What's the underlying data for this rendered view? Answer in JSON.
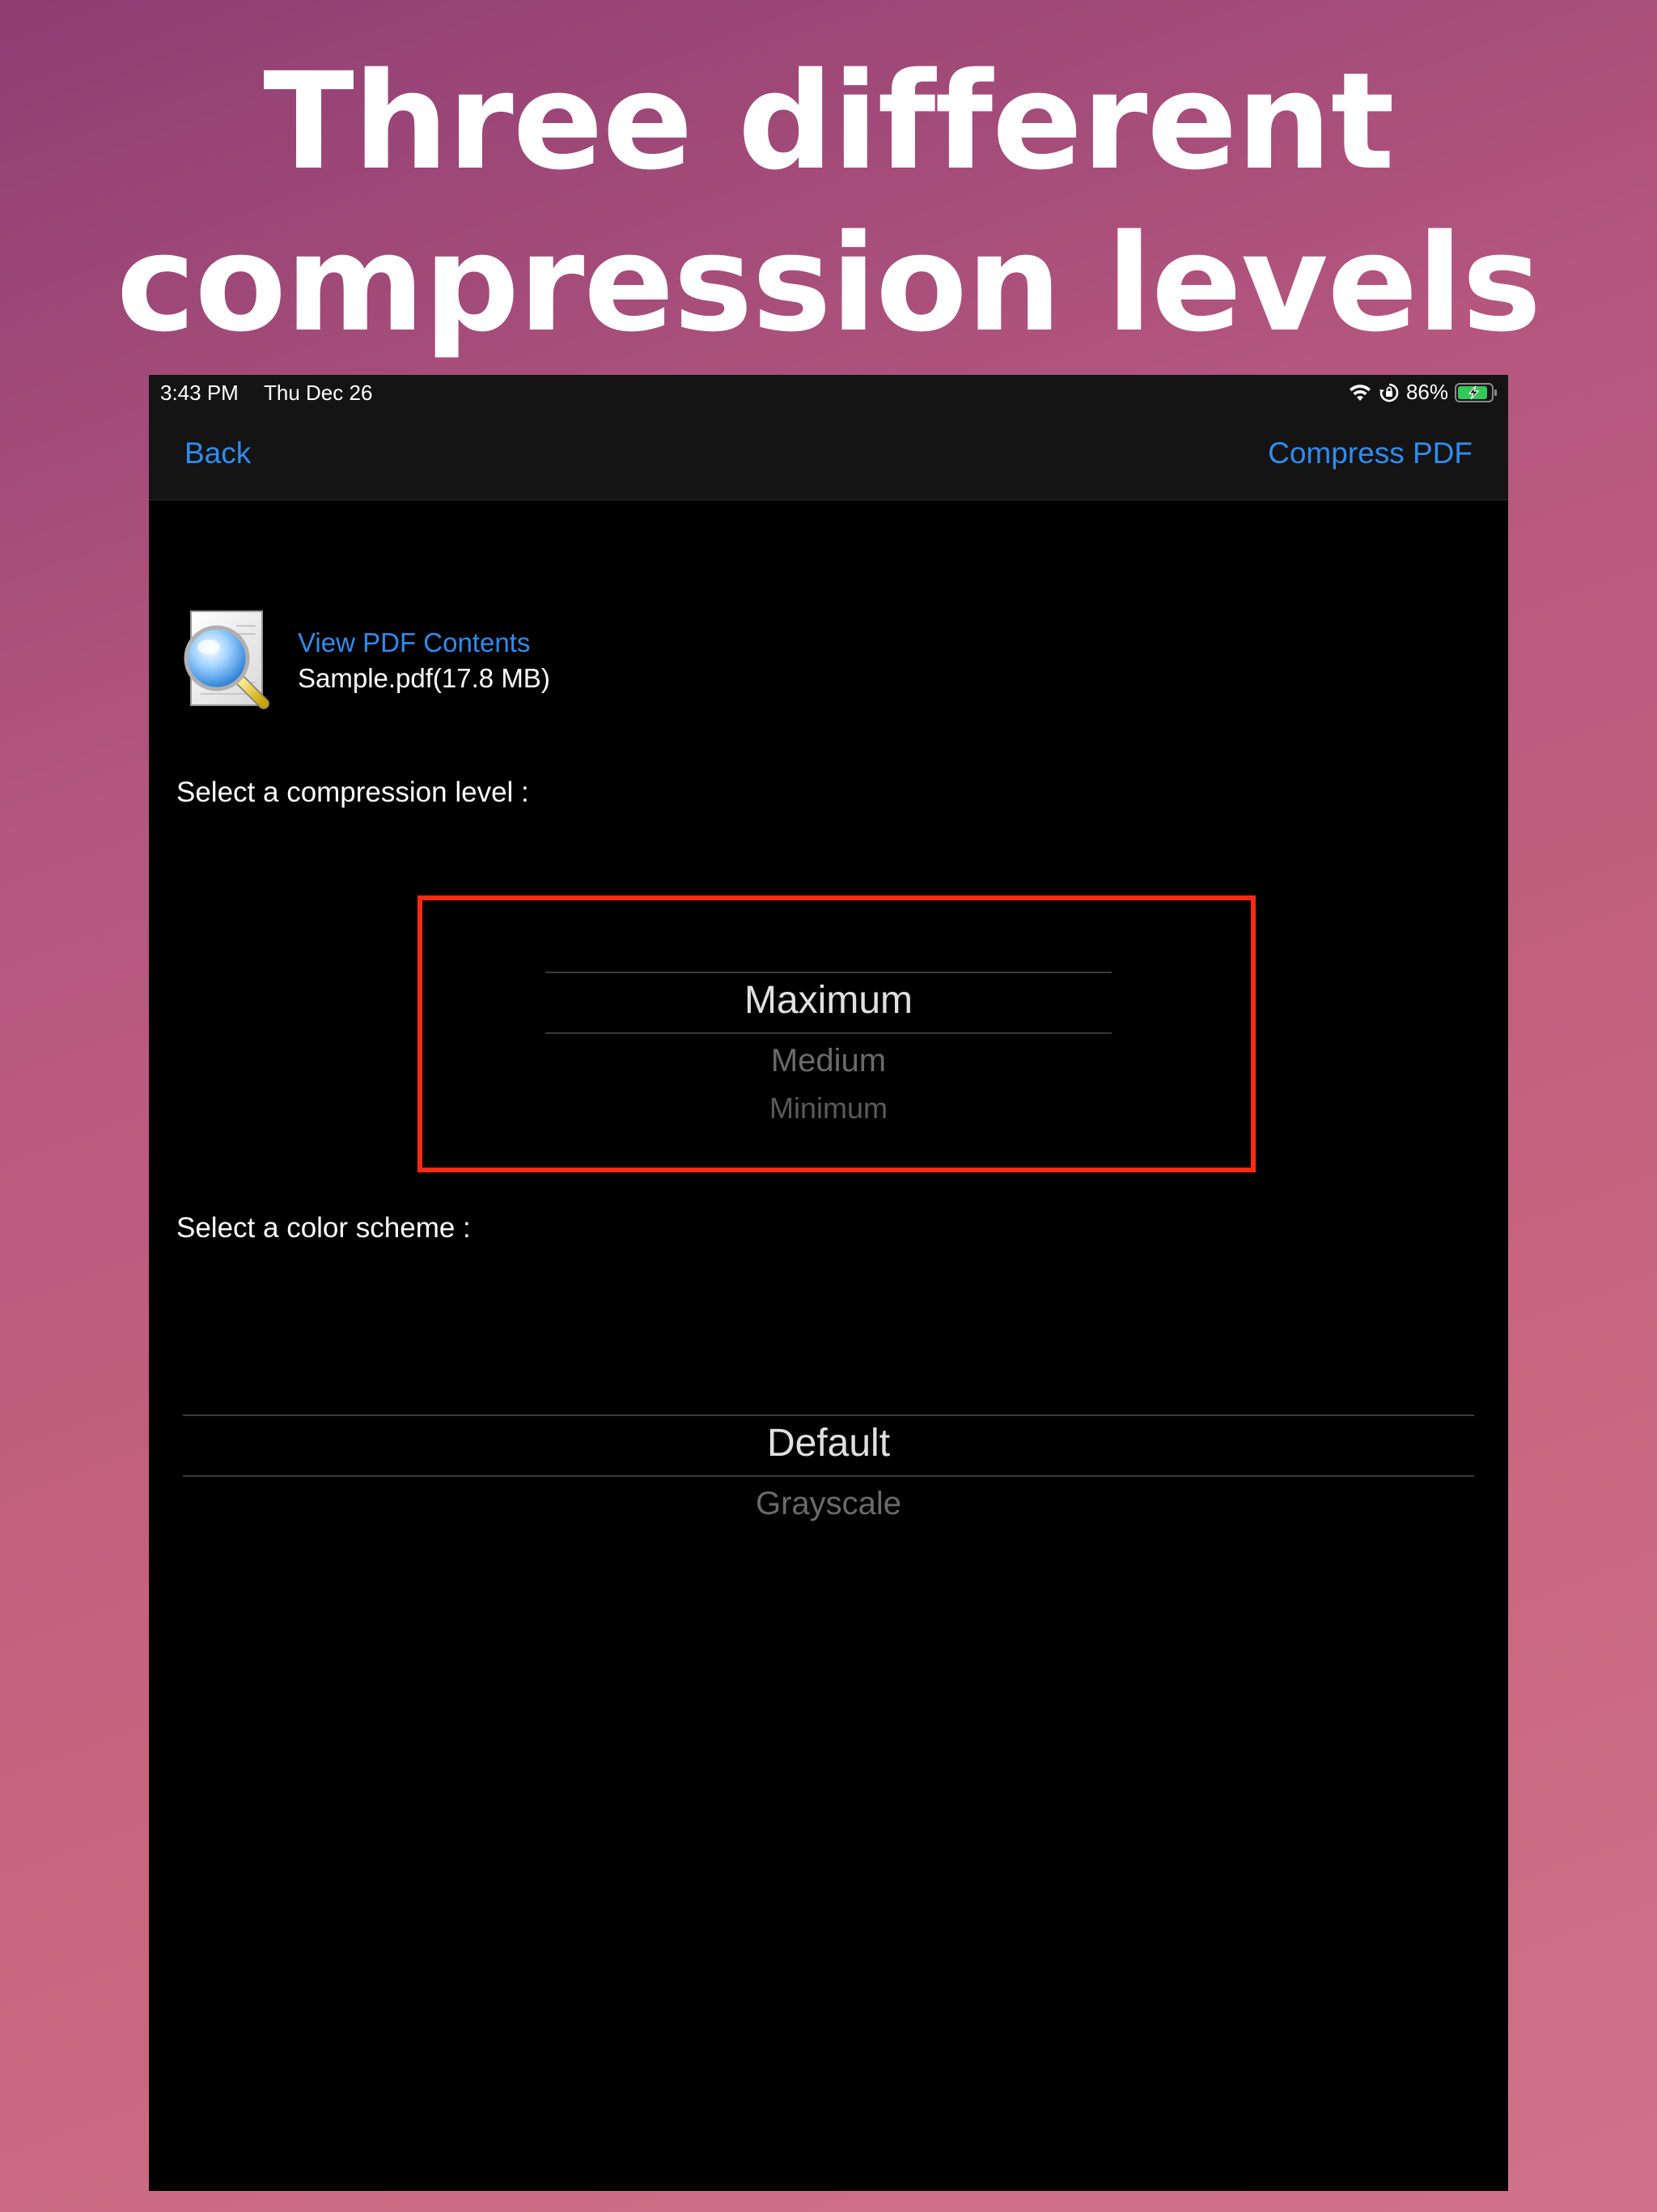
{
  "headline": {
    "line1": "Three different",
    "line2": "compression levels"
  },
  "status_bar": {
    "time": "3:43 PM",
    "date": "Thu Dec 26",
    "battery_percent": "86%",
    "icons": [
      "wifi-icon",
      "orientation-lock-icon",
      "battery-charging-icon"
    ]
  },
  "nav": {
    "back_label": "Back",
    "action_label": "Compress PDF"
  },
  "file": {
    "icon": "pdf-preview-magnifier-icon",
    "view_link": "View PDF Contents",
    "info": "Sample.pdf(17.8 MB)"
  },
  "compression": {
    "label": "Select a compression level :",
    "options": [
      "Maximum",
      "Medium",
      "Minimum"
    ],
    "selected": "Maximum"
  },
  "color_scheme": {
    "label": "Select a color scheme :",
    "options": [
      "Default",
      "Grayscale"
    ],
    "selected": "Default"
  },
  "colors": {
    "accent": "#2f8cf0",
    "highlight": "#ff2a14",
    "background_top": "#8e3e73",
    "background_bottom": "#d0728a"
  }
}
